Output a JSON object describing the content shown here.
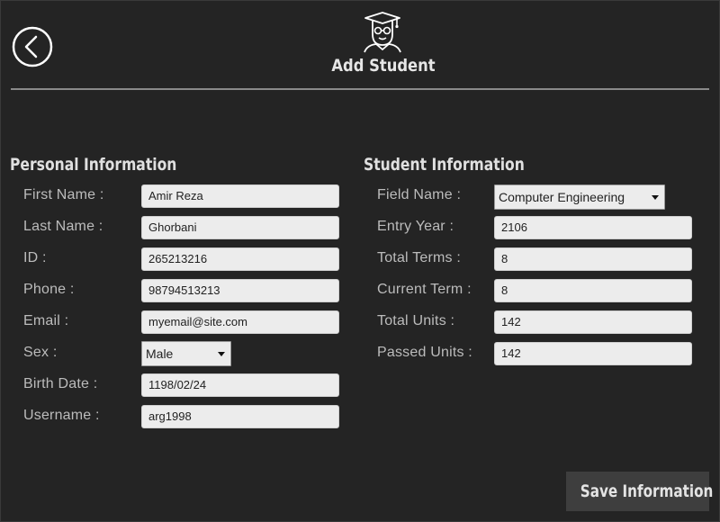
{
  "header": {
    "title": "Add Student",
    "logo_icon": "graduate-icon",
    "back_icon": "back-arrow-icon"
  },
  "personal": {
    "title": "Personal Information",
    "fields": [
      {
        "label": "First Name :",
        "value": "Amir Reza"
      },
      {
        "label": "Last Name :",
        "value": "Ghorbani"
      },
      {
        "label": "ID :",
        "value": "265213216"
      },
      {
        "label": "Phone :",
        "value": "98794513213"
      },
      {
        "label": "Email :",
        "value": "myemail@site.com"
      },
      {
        "label": "Sex :",
        "value": "Male"
      },
      {
        "label": "Birth Date :",
        "value": "1198/02/24"
      },
      {
        "label": "Username :",
        "value": "arg1998"
      }
    ]
  },
  "student": {
    "title": "Student Information",
    "fields": [
      {
        "label": "Field Name :",
        "value": "Computer Engineering"
      },
      {
        "label": "Entry Year :",
        "value": "2106"
      },
      {
        "label": "Total Terms :",
        "value": "8"
      },
      {
        "label": "Current Term :",
        "value": "8"
      },
      {
        "label": "Total Units :",
        "value": "142"
      },
      {
        "label": "Passed Units :",
        "value": "142"
      }
    ]
  },
  "actions": {
    "save_label": "Save Information"
  },
  "colors": {
    "background": "#242424",
    "input_bg": "#ececec",
    "button_bg": "#3e3e3e"
  }
}
